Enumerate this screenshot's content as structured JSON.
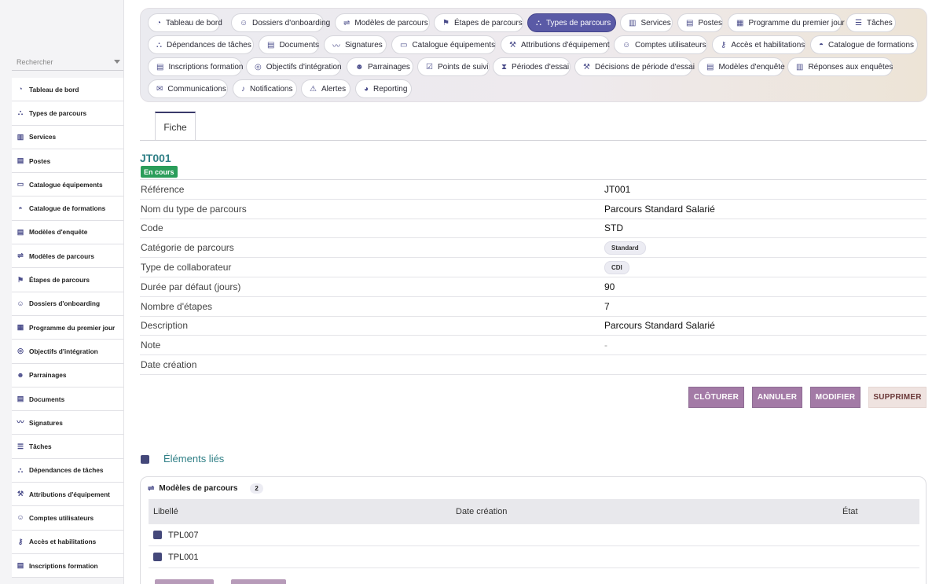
{
  "sidebar": {
    "search_placeholder": "Rechercher",
    "items": [
      {
        "label": "Tableau de bord",
        "icon": "◔"
      },
      {
        "label": "Types de parcours",
        "icon": "⛬"
      },
      {
        "label": "Services",
        "icon": "▥"
      },
      {
        "label": "Postes",
        "icon": "▤"
      },
      {
        "label": "Catalogue équipements",
        "icon": "▭"
      },
      {
        "label": "Catalogue de formations",
        "icon": "◓"
      },
      {
        "label": "Modèles d'enquête",
        "icon": "▤"
      },
      {
        "label": "Modèles de parcours",
        "icon": "⇌"
      },
      {
        "label": "Étapes de parcours",
        "icon": "⚑"
      },
      {
        "label": "Dossiers d'onboarding",
        "icon": "☺"
      },
      {
        "label": "Programme du premier jour",
        "icon": "▦"
      },
      {
        "label": "Objectifs d'intégration",
        "icon": "◎"
      },
      {
        "label": "Parrainages",
        "icon": "☻"
      },
      {
        "label": "Documents",
        "icon": "▤"
      },
      {
        "label": "Signatures",
        "icon": "〰"
      },
      {
        "label": "Tâches",
        "icon": "☰"
      },
      {
        "label": "Dépendances de tâches",
        "icon": "⛬"
      },
      {
        "label": "Attributions d'équipement",
        "icon": "⚒"
      },
      {
        "label": "Comptes utilisateurs",
        "icon": "☺"
      },
      {
        "label": "Accès et habilitations",
        "icon": "⚷"
      },
      {
        "label": "Inscriptions formation",
        "icon": "▤"
      }
    ]
  },
  "tabs": [
    {
      "label": "Tableau de bord",
      "icon": "◔",
      "active": false
    },
    {
      "label": "Dossiers d'onboarding",
      "icon": "☺",
      "active": false
    },
    {
      "label": "Modèles de parcours",
      "icon": "⇌",
      "active": false
    },
    {
      "label": "Étapes de parcours",
      "icon": "⚑",
      "active": false
    },
    {
      "label": "Types de parcours",
      "icon": "⛬",
      "active": true
    },
    {
      "label": "Services",
      "icon": "▥",
      "active": false
    },
    {
      "label": "Postes",
      "icon": "▤",
      "active": false
    },
    {
      "label": "Programme du premier jour",
      "icon": "▦",
      "active": false
    },
    {
      "label": "Tâches",
      "icon": "☰",
      "active": false
    },
    {
      "label": "Dépendances de tâches",
      "icon": "⛬",
      "active": false
    },
    {
      "label": "Documents",
      "icon": "▤",
      "active": false
    },
    {
      "label": "Signatures",
      "icon": "〰",
      "active": false
    },
    {
      "label": "Catalogue équipements",
      "icon": "▭",
      "active": false
    },
    {
      "label": "Attributions d'équipement",
      "icon": "⚒",
      "active": false
    },
    {
      "label": "Comptes utilisateurs",
      "icon": "☺",
      "active": false
    },
    {
      "label": "Accès et habilitations",
      "icon": "⚷",
      "active": false
    },
    {
      "label": "Catalogue de formations",
      "icon": "◓",
      "active": false
    },
    {
      "label": "Inscriptions formation",
      "icon": "▤",
      "active": false
    },
    {
      "label": "Objectifs d'intégration",
      "icon": "◎",
      "active": false
    },
    {
      "label": "Parrainages",
      "icon": "☻",
      "active": false
    },
    {
      "label": "Points de suivi",
      "icon": "☑",
      "active": false
    },
    {
      "label": "Périodes d'essai",
      "icon": "⧗",
      "active": false
    },
    {
      "label": "Décisions de période d'essai",
      "icon": "⚒",
      "active": false
    },
    {
      "label": "Modèles d'enquête",
      "icon": "▤",
      "active": false
    },
    {
      "label": "Réponses aux enquêtes",
      "icon": "▥",
      "active": false
    },
    {
      "label": "Communications",
      "icon": "✉",
      "active": false
    },
    {
      "label": "Notifications",
      "icon": "♪",
      "active": false
    },
    {
      "label": "Alertes",
      "icon": "⚠",
      "active": false
    },
    {
      "label": "Reporting",
      "icon": "◕",
      "active": false
    }
  ],
  "fiche_tab": "Fiche",
  "record": {
    "id": "JT001",
    "status": "En cours",
    "fields": [
      {
        "key": "Référence",
        "value": "JT001",
        "type": "text"
      },
      {
        "key": "Nom du type de parcours",
        "value": "Parcours Standard Salarié",
        "type": "text"
      },
      {
        "key": "Code",
        "value": "STD",
        "type": "text"
      },
      {
        "key": "Catégorie de parcours",
        "value": "Standard",
        "type": "pill"
      },
      {
        "key": "Type de collaborateur",
        "value": "CDI",
        "type": "pill"
      },
      {
        "key": "Durée par défaut (jours)",
        "value": "90",
        "type": "text"
      },
      {
        "key": "Nombre d'étapes",
        "value": "7",
        "type": "text"
      },
      {
        "key": "Description",
        "value": "Parcours Standard Salarié",
        "type": "text"
      },
      {
        "key": "Note",
        "value": "-",
        "type": "muted"
      },
      {
        "key": "Date création",
        "value": "",
        "type": "text"
      }
    ]
  },
  "actions": {
    "close": "CLÔTURER",
    "cancel": "ANNULER",
    "edit": "MODIFIER",
    "delete": "SUPPRIMER"
  },
  "linked": {
    "title": "Éléments liés",
    "card_title": "Modèles de parcours",
    "count": "2",
    "columns": [
      "Libellé",
      "Date création",
      "État"
    ],
    "rows": [
      {
        "label": "TPL007",
        "date": "",
        "state_color": "#2a9d5a"
      },
      {
        "label": "TPL001",
        "date": "",
        "state_color": "#2a9d5a"
      }
    ]
  }
}
